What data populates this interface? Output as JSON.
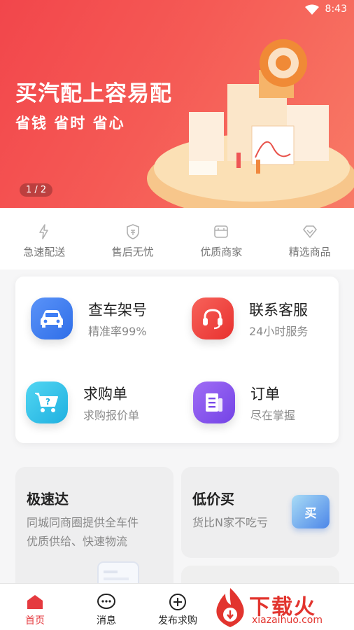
{
  "status_bar": {
    "time": "8:43"
  },
  "banner": {
    "title": "买汽配上容易配",
    "subtitle": "省钱 省时 省心",
    "pager": "1 / 2"
  },
  "features": [
    {
      "label": "急速配送",
      "icon": "lightning-icon"
    },
    {
      "label": "售后无忧",
      "icon": "shield-icon"
    },
    {
      "label": "优质商家",
      "icon": "shop-icon"
    },
    {
      "label": "精选商品",
      "icon": "diamond-icon"
    }
  ],
  "services": [
    {
      "title": "查车架号",
      "desc": "精准率99%",
      "icon": "car-icon",
      "color": "#3f7ef5"
    },
    {
      "title": "联系客服",
      "desc": "24小时服务",
      "icon": "headset-icon",
      "color": "#f0453f"
    },
    {
      "title": "求购单",
      "desc": "求购报价单",
      "icon": "cart-icon",
      "color": "#2fc0e8"
    },
    {
      "title": "订单",
      "desc": "尽在掌握",
      "icon": "order-icon",
      "color": "#8a55ee"
    }
  ],
  "cards": {
    "fast": {
      "title": "极速达",
      "desc1": "同城同商圈提供全车件",
      "desc2": "优质供给、快速物流"
    },
    "cheap": {
      "title": "低价买",
      "desc": "货比N家不吃亏",
      "badge": "买"
    }
  },
  "tabbar": {
    "home": "首页",
    "messages": "消息",
    "post": "发布求购"
  },
  "watermark": {
    "text": "下载火",
    "url": "xiazaihuo.com"
  },
  "colors": {
    "primary": "#e53a3f",
    "banner": "#f2464b"
  }
}
